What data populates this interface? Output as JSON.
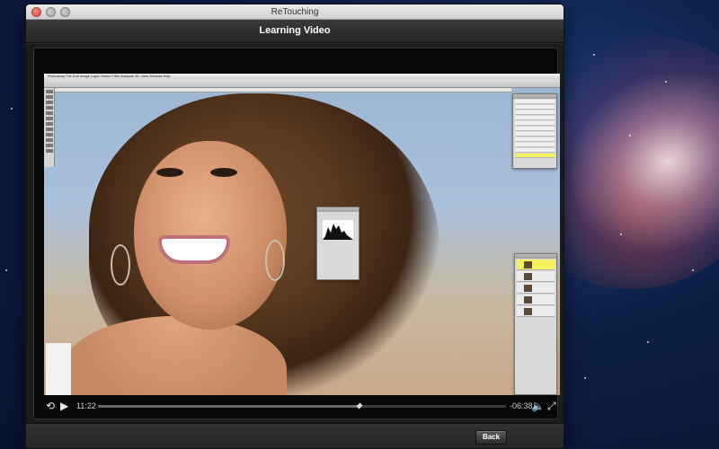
{
  "window": {
    "title": "ReTouching"
  },
  "header": {
    "title": "Learning Video"
  },
  "video": {
    "app_menu_text": "Photoshop  File  Edit  Image  Layer  Select  Filter  Analysis  3D  View  Window  Help",
    "progress_fraction": 0.64
  },
  "player": {
    "elapsed": "11:22",
    "remaining": "-06:38",
    "icons": {
      "rewind": "replay-icon",
      "play": "play-icon",
      "volume": "volume-icon",
      "fullscreen": "fullscreen-icon"
    }
  },
  "footer": {
    "back_label": "Back"
  }
}
